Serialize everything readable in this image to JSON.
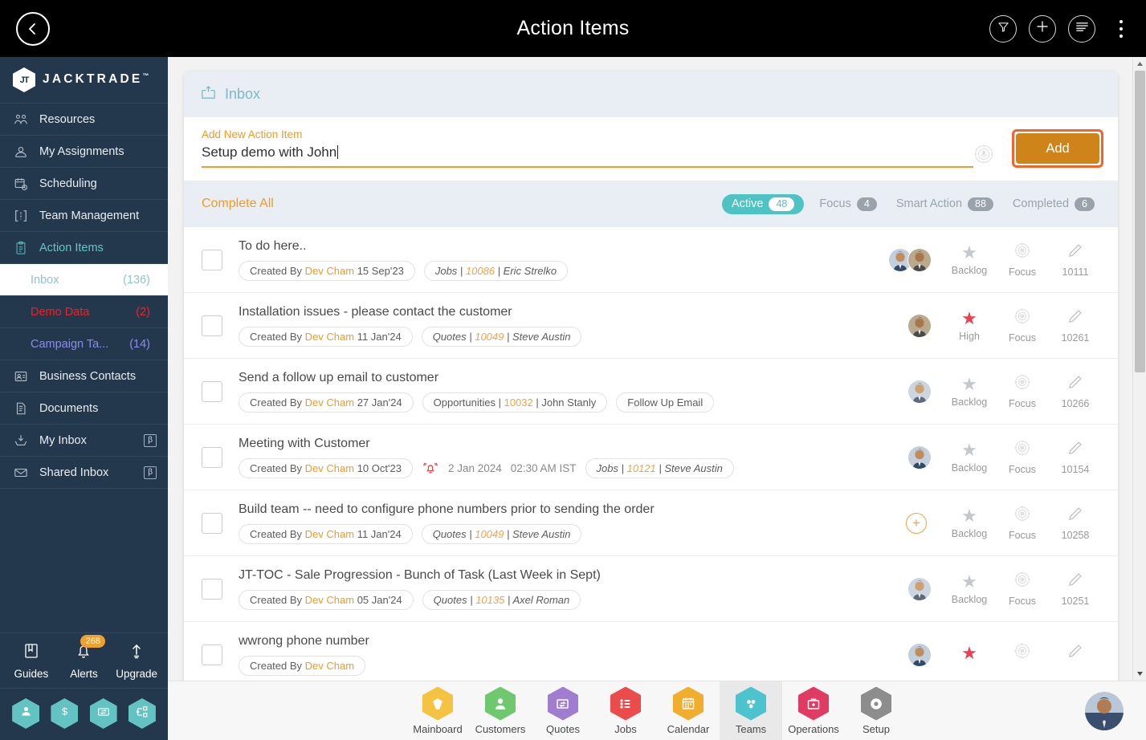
{
  "topbar": {
    "title": "Action Items",
    "back_icon": "chevron-left-icon",
    "filter_icon": "funnel-icon",
    "add_icon": "plus-icon",
    "list_icon": "list-lines-icon",
    "more_icon": "kebab-menu-icon"
  },
  "sidebar": {
    "brand": "JACKTRADE",
    "brand_tm": "™",
    "brand_mark": "JT",
    "items": [
      {
        "label": "Resources",
        "icon": "resources-icon",
        "active": false,
        "beta": ""
      },
      {
        "label": "My Assignments",
        "icon": "assignments-icon",
        "active": false,
        "beta": ""
      },
      {
        "label": "Scheduling",
        "icon": "calendar-clock-icon",
        "active": false,
        "beta": ""
      },
      {
        "label": "Team Management",
        "icon": "team-brackets-icon",
        "active": false,
        "beta": ""
      },
      {
        "label": "Action Items",
        "icon": "clipboard-icon",
        "active": true,
        "beta": ""
      }
    ],
    "subitems": [
      {
        "label": "Inbox",
        "count": "(136)",
        "state": "sel"
      },
      {
        "label": "Demo Data",
        "count": "(2)",
        "state": "red"
      },
      {
        "label": "Campaign Ta...",
        "count": "(14)",
        "state": "blue"
      }
    ],
    "items2": [
      {
        "label": "Business Contacts",
        "icon": "contact-card-icon",
        "active": false,
        "beta": ""
      },
      {
        "label": "Documents",
        "icon": "document-icon",
        "active": false,
        "beta": ""
      },
      {
        "label": "My Inbox",
        "icon": "inbox-download-icon",
        "active": false,
        "beta": "β"
      },
      {
        "label": "Shared Inbox",
        "icon": "envelope-icon",
        "active": false,
        "beta": "β"
      }
    ],
    "tools": [
      {
        "label": "Guides",
        "icon": "book-icon",
        "badge": ""
      },
      {
        "label": "Alerts",
        "icon": "bell-icon",
        "badge": "268"
      },
      {
        "label": "Upgrade",
        "icon": "arrow-up-icon",
        "badge": ""
      }
    ],
    "hex_shortcuts": [
      {
        "icon": "person-icon"
      },
      {
        "icon": "dollar-icon"
      },
      {
        "icon": "money-transfer-icon"
      },
      {
        "icon": "workflow-icon"
      }
    ],
    "accent": "#5fc8c8",
    "background": "#24384d"
  },
  "panel": {
    "header_title": "Inbox",
    "header_icon": "inbox-tray-icon",
    "add_caption": "Add New Action Item",
    "add_value": "Setup demo with John",
    "add_placeholder": "Add New Action Item",
    "mic_icon": "voice-input-icon",
    "add_button": "Add",
    "complete_all": "Complete All",
    "tabs": [
      {
        "label": "Active",
        "count": "48",
        "selected": true
      },
      {
        "label": "Focus",
        "count": "4",
        "selected": false
      },
      {
        "label": "Smart Action",
        "count": "88",
        "selected": false
      },
      {
        "label": "Completed",
        "count": "6",
        "selected": false
      }
    ]
  },
  "rows": [
    {
      "title": "To do here..",
      "created_prefix": "Created By",
      "created_by": "Dev Cham",
      "created_date": "15 Sep'23",
      "ref_type": "Jobs",
      "ref_num": "10086",
      "ref_person": "Eric Strelko",
      "ref_italic": true,
      "extra_tag": "",
      "reminder_date": "",
      "reminder_time": "",
      "avatars": 2,
      "plus": false,
      "priority": "Backlog",
      "priority_high": false,
      "focus_label": "Focus",
      "id": "10111"
    },
    {
      "title": "Installation issues - please contact the customer",
      "created_prefix": "Created By",
      "created_by": "Dev Cham",
      "created_date": "11 Jan'24",
      "ref_type": "Quotes",
      "ref_num": "10049",
      "ref_person": "Steve Austin",
      "ref_italic": true,
      "extra_tag": "",
      "reminder_date": "",
      "reminder_time": "",
      "avatars": 1,
      "plus": false,
      "priority": "High",
      "priority_high": true,
      "focus_label": "Focus",
      "id": "10261"
    },
    {
      "title": "Send a follow up email to customer",
      "created_prefix": "Created By",
      "created_by": "Dev Cham",
      "created_date": "27 Jan'24",
      "ref_type": "Opportunities",
      "ref_num": "10032",
      "ref_person": "John Stanly",
      "ref_italic": false,
      "extra_tag": "Follow Up Email",
      "reminder_date": "",
      "reminder_time": "",
      "avatars": 1,
      "plus": false,
      "priority": "Backlog",
      "priority_high": false,
      "focus_label": "Focus",
      "id": "10266"
    },
    {
      "title": "Meeting with Customer",
      "created_prefix": "Created By",
      "created_by": "Dev Cham",
      "created_date": "10 Oct'23",
      "ref_type": "Jobs",
      "ref_num": "10121",
      "ref_person": "Steve Austin",
      "ref_italic": true,
      "extra_tag": "",
      "reminder_date": "2 Jan 2024",
      "reminder_time": "02:30 AM IST",
      "avatars": 1,
      "plus": false,
      "priority": "Backlog",
      "priority_high": false,
      "focus_label": "Focus",
      "id": "10154"
    },
    {
      "title": "Build team -- need to configure phone numbers prior to sending the order",
      "created_prefix": "Created By",
      "created_by": "Dev Cham",
      "created_date": "11 Jan'24",
      "ref_type": "Quotes",
      "ref_num": "10049",
      "ref_person": "Steve Austin",
      "ref_italic": true,
      "extra_tag": "",
      "reminder_date": "",
      "reminder_time": "",
      "avatars": 0,
      "plus": true,
      "priority": "Backlog",
      "priority_high": false,
      "focus_label": "Focus",
      "id": "10258"
    },
    {
      "title": "JT-TOC - Sale Progression - Bunch of Task (Last Week in Sept)",
      "created_prefix": "Created By",
      "created_by": "Dev Cham",
      "created_date": "05 Jan'24",
      "ref_type": "Quotes",
      "ref_num": "10135",
      "ref_person": "Axel Roman",
      "ref_italic": true,
      "extra_tag": "",
      "reminder_date": "",
      "reminder_time": "",
      "avatars": 1,
      "plus": false,
      "priority": "Backlog",
      "priority_high": false,
      "focus_label": "Focus",
      "id": "10251"
    },
    {
      "title": "wwrong phone number",
      "created_prefix": "Created By",
      "created_by": "Dev Cham",
      "created_date": "",
      "ref_type": "",
      "ref_num": "",
      "ref_person": "",
      "ref_italic": true,
      "extra_tag": "",
      "reminder_date": "",
      "reminder_time": "",
      "avatars": 1,
      "plus": false,
      "priority": "",
      "priority_high": true,
      "focus_label": "",
      "id": ""
    }
  ],
  "bottomnav": {
    "items": [
      {
        "label": "Mainboard",
        "icon": "mainboard-icon",
        "color": "#f5c242",
        "selected": false
      },
      {
        "label": "Customers",
        "icon": "customers-icon",
        "color": "#6ec96e",
        "selected": false
      },
      {
        "label": "Quotes",
        "icon": "quotes-icon",
        "color": "#a07dd0",
        "selected": false
      },
      {
        "label": "Jobs",
        "icon": "jobs-icon",
        "color": "#ec4b4b",
        "selected": false
      },
      {
        "label": "Calendar",
        "icon": "calendar-icon",
        "color": "#f0ad2e",
        "selected": false
      },
      {
        "label": "Teams",
        "icon": "teams-icon",
        "color": "#4dc3cd",
        "selected": true
      },
      {
        "label": "Operations",
        "icon": "operations-icon",
        "color": "#e03b63",
        "selected": false
      },
      {
        "label": "Setup",
        "icon": "setup-icon",
        "color": "#8d8d8d",
        "selected": false
      }
    ],
    "user_avatar": "user-avatar"
  },
  "scrollbar": {
    "up_icon": "scroll-up-arrow-icon",
    "down_icon": "scroll-down-arrow-icon"
  }
}
